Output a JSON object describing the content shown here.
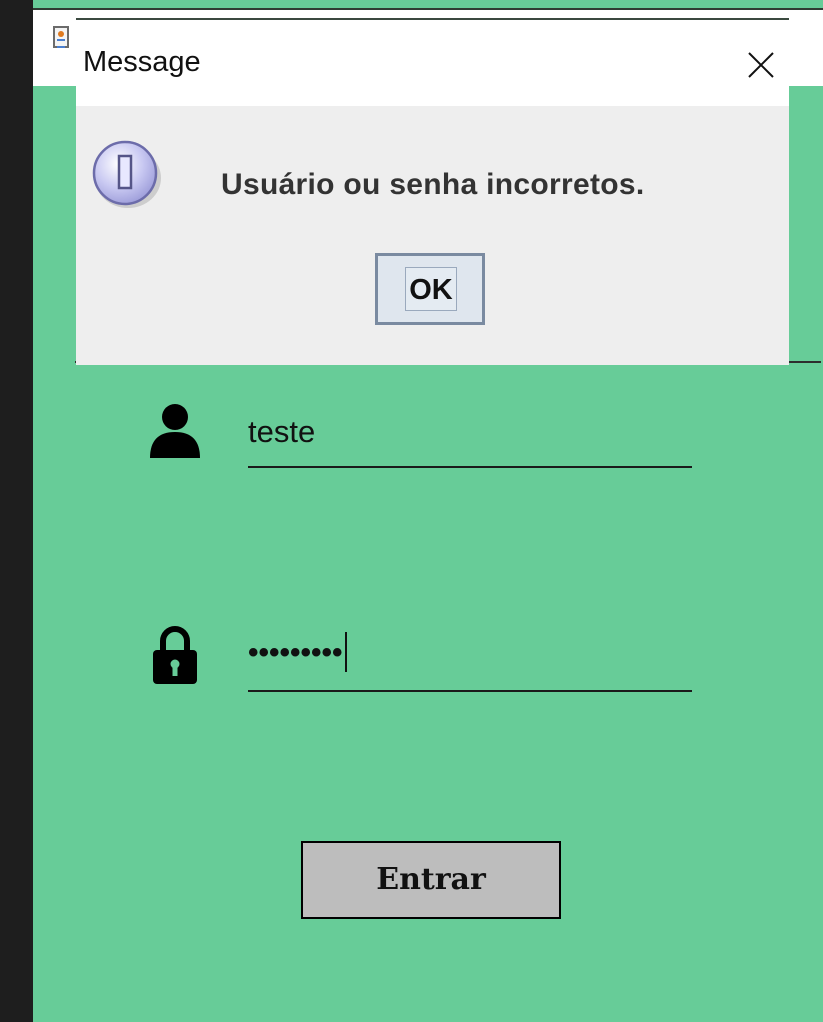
{
  "main_window": {
    "username_value": "teste",
    "password_value": "•••••••••",
    "enter_label": "Entrar",
    "icons": [
      "app-icon",
      "user-icon",
      "lock-icon"
    ]
  },
  "dialog": {
    "title": "Message",
    "message": "Usuário ou senha incorretos.",
    "ok_label": "OK",
    "icons": [
      "info-icon",
      "close-icon"
    ]
  },
  "colors": {
    "background_green": "#67cc98",
    "dialog_body": "#eeeeee",
    "button_gray": "#bdbdbd"
  }
}
